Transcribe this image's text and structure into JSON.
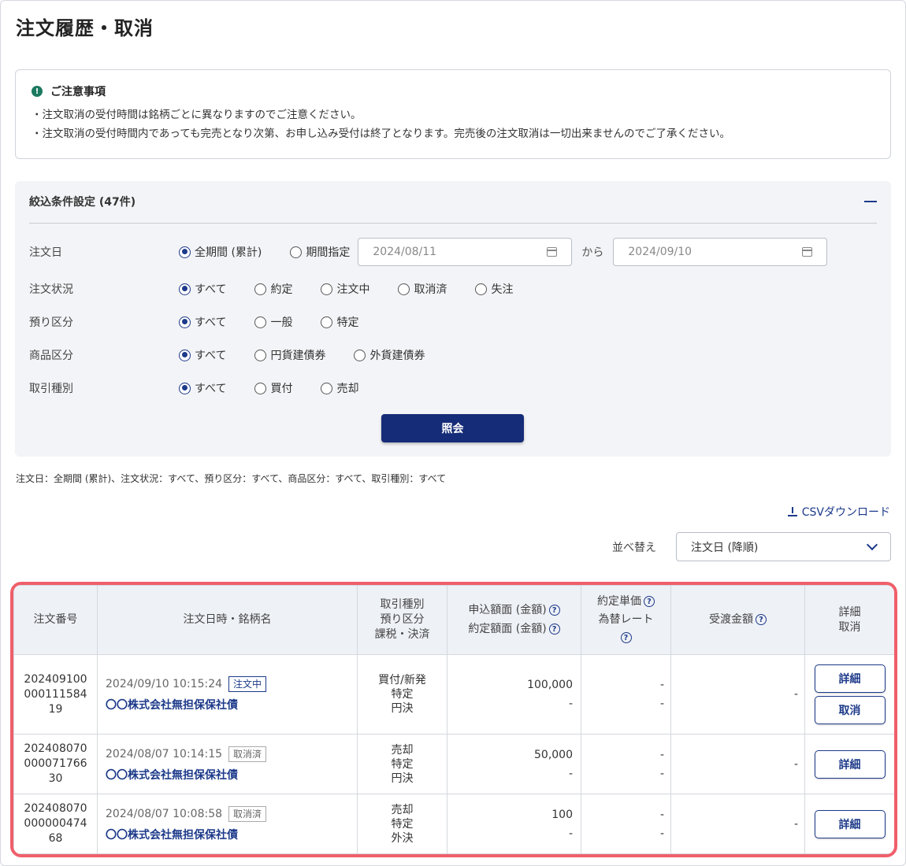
{
  "page": {
    "title": "注文履歴・取消"
  },
  "notice": {
    "title": "ご注意事項",
    "icon": "alert-icon",
    "lines": [
      "・注文取消の受付時間は銘柄ごとに異なりますのでご注意ください。",
      "・注文取消の受付時間内であっても完売となり次第、お申し込み受付は終了となります。完売後の注文取消は一切出来ませんのでご了承ください。"
    ]
  },
  "filter": {
    "title": "絞込条件設定 (47件)",
    "order_date": {
      "label": "注文日",
      "options": [
        "全期間 (累計)",
        "期間指定"
      ],
      "selected": 0,
      "from_date": "2024/08/11",
      "to_date": "2024/09/10",
      "from_label": "から"
    },
    "status": {
      "label": "注文状況",
      "options": [
        "すべて",
        "約定",
        "注文中",
        "取消済",
        "失注"
      ],
      "selected": 0
    },
    "deposit": {
      "label": "預り区分",
      "options": [
        "すべて",
        "一般",
        "特定"
      ],
      "selected": 0
    },
    "product": {
      "label": "商品区分",
      "options": [
        "すべて",
        "円貨建債券",
        "外貨建債券"
      ],
      "selected": 0
    },
    "trade": {
      "label": "取引種別",
      "options": [
        "すべて",
        "買付",
        "売却"
      ],
      "selected": 0
    },
    "search_label": "照会"
  },
  "summary": "注文日：全期間 (累計)、注文状況：すべて、預り区分：すべて、商品区分：すべて、取引種別：すべて",
  "csv_label": "CSVダウンロード",
  "sort": {
    "label": "並べ替え",
    "value": "注文日 (降順)"
  },
  "table": {
    "headers": {
      "order_no": "注文番号",
      "datetime": "注文日時・銘柄名",
      "type_line1": "取引種別",
      "type_line2": "預り区分",
      "type_line3": "課税・決済",
      "amount_line1": "申込額面 (金額)",
      "amount_line2": "約定額面 (金額)",
      "rate_line1": "約定単価",
      "rate_line2": "為替レート",
      "total": "受渡金額",
      "action_line1": "詳細",
      "action_line2": "取消"
    },
    "rows": [
      {
        "order_no": [
          "202409100",
          "000111584",
          "19"
        ],
        "datetime": "2024/09/10 10:15:24",
        "status": "注文中",
        "bond": "〇〇株式会社無担保保社債",
        "type": [
          "買付/新発",
          "特定",
          "円決"
        ],
        "applied": "100,000",
        "executed": "-",
        "price": "-",
        "fx": "-",
        "total": "-",
        "detail": "詳細",
        "cancel": "取消"
      },
      {
        "order_no": [
          "202408070",
          "000071766",
          "30"
        ],
        "datetime": "2024/08/07 10:14:15",
        "status": "取消済",
        "bond": "〇〇株式会社無担保保社債",
        "type": [
          "売却",
          "特定",
          "円決"
        ],
        "applied": "50,000",
        "executed": "-",
        "price": "-",
        "fx": "-",
        "total": "-",
        "detail": "詳細"
      },
      {
        "order_no": [
          "202408070",
          "000000474",
          "68"
        ],
        "datetime": "2024/08/07 10:08:58",
        "status": "取消済",
        "bond": "〇〇株式会社無担保保社債",
        "type": [
          "売却",
          "特定",
          "外決"
        ],
        "applied": "100",
        "executed": "-",
        "price": "-",
        "fx": "-",
        "total": "-",
        "detail": "詳細"
      }
    ]
  }
}
